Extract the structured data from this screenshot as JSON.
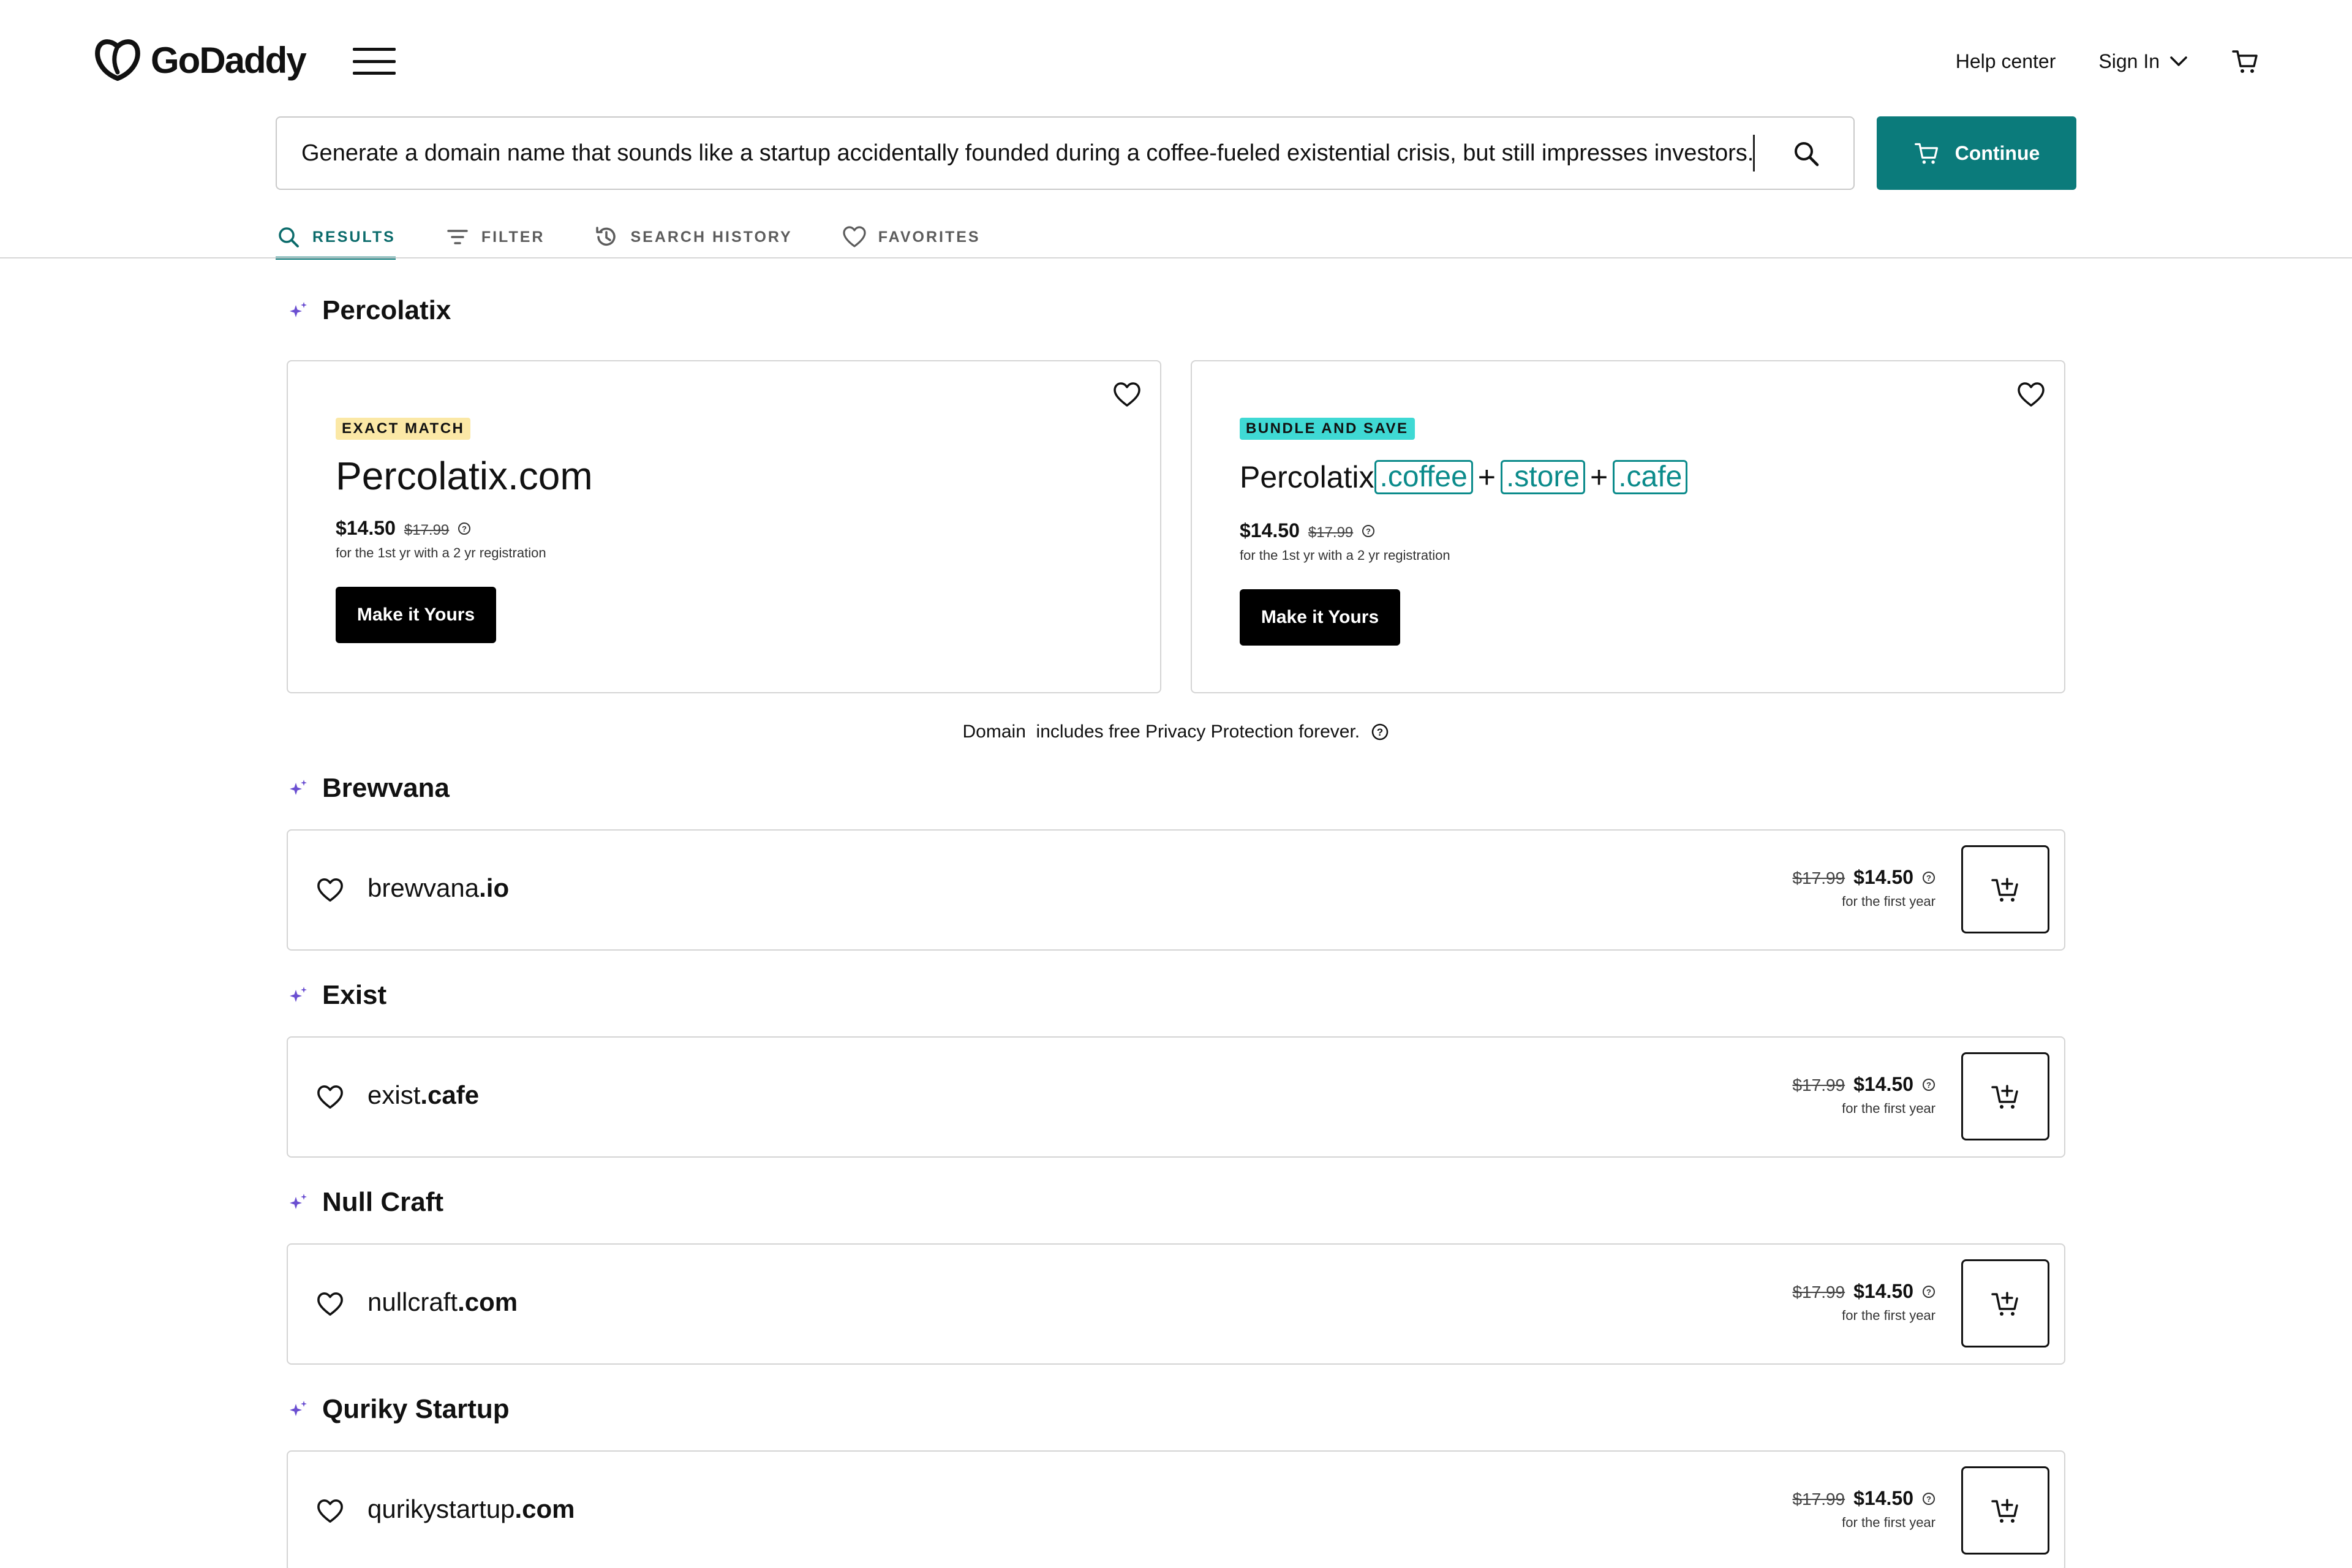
{
  "header": {
    "logo_text": "GoDaddy",
    "help_center": "Help center",
    "sign_in": "Sign In"
  },
  "search": {
    "value": "Generate a domain name that sounds like a startup accidentally founded during a coffee-fueled existential crisis, but still impresses investors.",
    "continue_label": "Continue"
  },
  "tabs": [
    {
      "label": "RESULTS",
      "active": true
    },
    {
      "label": "FILTER",
      "active": false
    },
    {
      "label": "SEARCH HISTORY",
      "active": false
    },
    {
      "label": "FAVORITES",
      "active": false
    }
  ],
  "featured": {
    "title": "Percolatix",
    "exact": {
      "badge": "EXACT MATCH",
      "domain": "Percolatix.com",
      "price": "$14.50",
      "old_price": "$17.99",
      "sub": "for the 1st yr with a 2 yr registration",
      "button": "Make it Yours"
    },
    "bundle": {
      "badge": "BUNDLE AND SAVE",
      "name": "Percolatix",
      "tlds": [
        ".coffee",
        ".store",
        ".cafe"
      ],
      "plus": "+",
      "price": "$14.50",
      "old_price": "$17.99",
      "sub": "for the 1st yr with a 2 yr registration",
      "button": "Make it Yours"
    }
  },
  "privacy_note": "Domain  includes free Privacy Protection forever.",
  "results": [
    {
      "title": "Brewvana",
      "name": "brewvana",
      "tld": ".io",
      "old_price": "$17.99",
      "price": "$14.50",
      "sub": "for the first year"
    },
    {
      "title": "Exist",
      "name": "exist",
      "tld": ".cafe",
      "old_price": "$17.99",
      "price": "$14.50",
      "sub": "for the first year"
    },
    {
      "title": "Null Craft",
      "name": "nullcraft",
      "tld": ".com",
      "old_price": "$17.99",
      "price": "$14.50",
      "sub": "for the first year"
    },
    {
      "title": "Quriky Startup",
      "name": "qurikystartup",
      "tld": ".com",
      "old_price": "$17.99",
      "price": "$14.50",
      "sub": "for the first year"
    }
  ],
  "colors": {
    "brand_teal": "#0b7b7b",
    "exact_badge": "#fbe8a6",
    "bundle_badge": "#3fd9d4",
    "sparkle": "#6b4fd1"
  },
  "icons": [
    "godaddy-logo-icon",
    "menu-icon",
    "chevron-down-icon",
    "cart-icon",
    "search-icon",
    "filter-icon",
    "history-icon",
    "heart-icon",
    "sparkle-icon",
    "info-icon",
    "add-to-cart-icon"
  ]
}
